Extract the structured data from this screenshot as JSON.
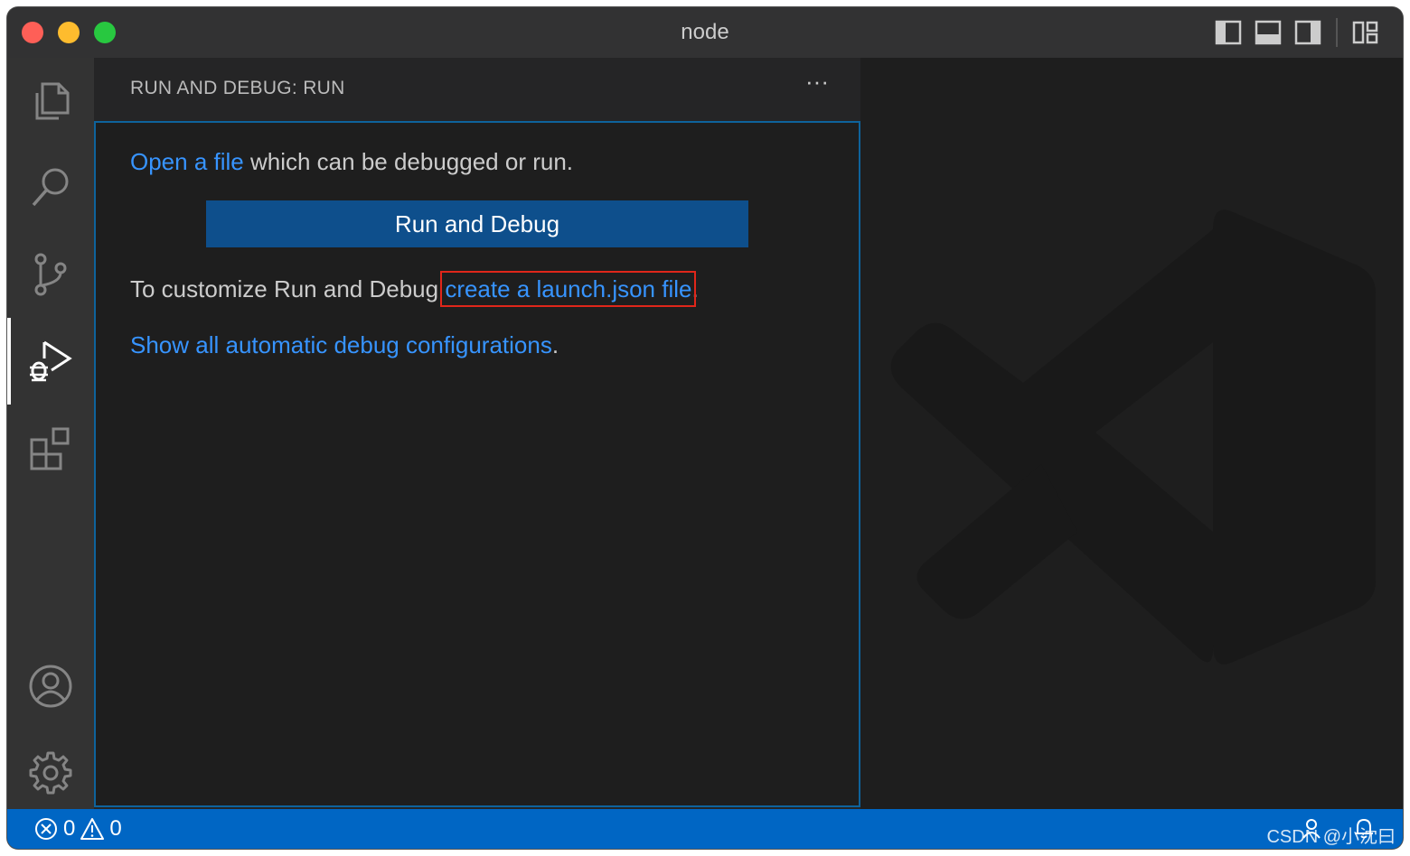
{
  "window": {
    "title": "node"
  },
  "sidebar": {
    "header": "RUN AND DEBUG: RUN",
    "more_label": "···",
    "welcome": {
      "line1_link": "Open a file",
      "line1_text": " which can be debugged or run.",
      "run_button": "Run and Debug",
      "line2_text": "To customize Run and Debug ",
      "line2_link": "create a launch.json file",
      "line2_end": ".",
      "line3_link": "Show all automatic debug configurations",
      "line3_end": "."
    }
  },
  "statusbar": {
    "errors": "0",
    "warnings": "0"
  },
  "watermark": "CSDN @小沈曰",
  "colors": {
    "accent": "#0066c4",
    "link": "#3794ff",
    "button": "#0e4f8c",
    "highlight": "#e0261a"
  }
}
